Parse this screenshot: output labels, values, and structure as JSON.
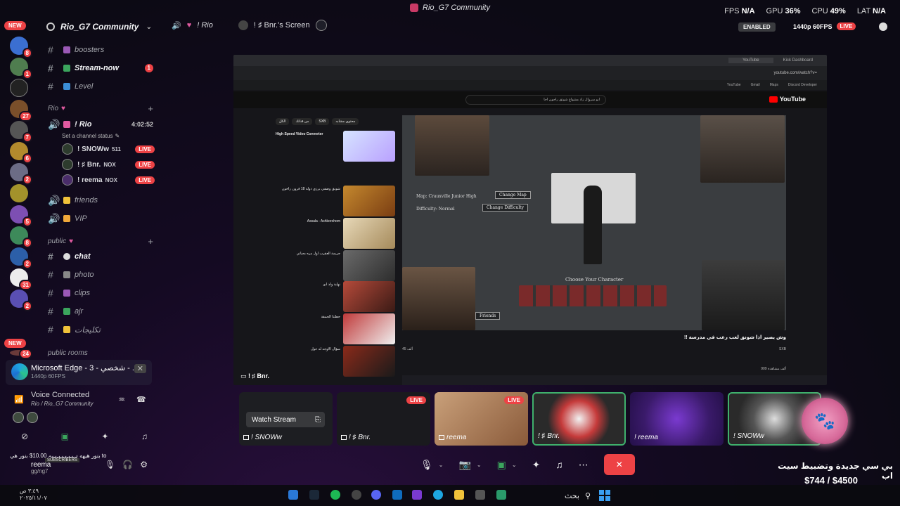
{
  "window": {
    "title": "Rio_G7 Community"
  },
  "perf": {
    "fps_label": "FPS",
    "fps": "N/A",
    "gpu_label": "GPU",
    "gpu": "36%",
    "cpu_label": "CPU",
    "cpu": "49%",
    "lat_label": "LAT",
    "lat": "N/A"
  },
  "rail": {
    "new_top": "NEW",
    "new_bottom": "NEW",
    "badges": [
      "8",
      "1",
      "",
      "27",
      "7",
      "6",
      "2",
      "",
      "5",
      "8",
      "2",
      "31",
      "2",
      "24"
    ]
  },
  "server": {
    "name": "Rio_G7 Community"
  },
  "channels": {
    "top": [
      {
        "name": "boosters"
      },
      {
        "name": "Stream-now",
        "count": "1"
      },
      {
        "name": "Level"
      }
    ],
    "cat_rio": "Rio",
    "voice_channel": "! Rio",
    "voice_time": "4:02:52",
    "set_status": "Set a channel status",
    "voice_users": [
      {
        "name": "! SNOWw",
        "tag": "511",
        "live": "LIVE"
      },
      {
        "name": "! ♯ Bnr.",
        "tag": "NOX",
        "live": "LIVE"
      },
      {
        "name": "! reema",
        "tag": "NOX",
        "live": "LIVE"
      }
    ],
    "friends": "friends",
    "vip": "VIP",
    "cat_public": "public",
    "public": [
      "chat",
      "photo",
      "clips",
      "ajr",
      "تكليجات"
    ],
    "cat_rooms": "public rooms"
  },
  "edge_card": {
    "title": "Microsoft Edge - 3 - شخصي - ...",
    "sub": "1440p 60FPS",
    "close": "✕"
  },
  "voice": {
    "status": "Voice Connected",
    "channel": "Rio / Rio_G7 Community"
  },
  "user_panel": {
    "ticker": "بنور هيهه  ہہہہہہہہہ 10.00$ بنور هي to",
    "subs_label": "SUBSCRIBERS",
    "name": "reema",
    "status": "gg/ng7"
  },
  "voice_header": {
    "channel": "! Rio",
    "screen": "! ♯ Bnr.'s Screen"
  },
  "stream_badges": {
    "enabled": "ENABLED",
    "quality": "1440p 60FPS",
    "live": "LIVE"
  },
  "stream": {
    "label": "! ♯ Bnr.",
    "yt_search": "ابو سروال زاد مشواع شوتق راحون احا",
    "yt_logo": "YouTube",
    "chips": [
      "الكل",
      "من قناتك",
      "SXB",
      "محتوى مشابه"
    ],
    "sidebar_videos": [
      "High Speed Video Converter",
      "شونق وصفي يرزي دولة 18 قرون راحون",
      "Assala - Ashkorohom",
      "جريمة العقرب اول مره بحياتي",
      "نهاية ولد ابو",
      "حطتنا الحمقة",
      "سؤال الاوجه له حول"
    ],
    "game_map": "Map: Crauxville Junior High",
    "game_difficulty": "Difficulty: Normal",
    "btn_map": "Change Map",
    "btn_difficulty": "Change Difficulty",
    "choose": "Choose Your Character",
    "friends_btn": "Friends",
    "video_title": "!! وش يصير اذا شونق لعب رعب في مدرسة",
    "channel": "SXB",
    "likes": "45 ألف",
    "views": "909 ألف مشاهدة"
  },
  "tiles": [
    {
      "name": "! SNOWw",
      "watch": "Watch Stream"
    },
    {
      "name": "! ♯ Bnr.",
      "live": "LIVE"
    },
    {
      "name": "reema",
      "live": "LIVE"
    },
    {
      "name": "! ♯ Bnr."
    },
    {
      "name": "! reema"
    },
    {
      "name": "! SNOWw"
    }
  ],
  "goal": {
    "text": "بي سي جديدة وتضبيط سيت اب",
    "amount": "$744 / $4500"
  },
  "taskbar": {
    "time": "٣:٤٩ ص",
    "date": "٢٠٢٥/١١/٠٧",
    "search": "بحث"
  },
  "colors": {
    "live": "#ed4245",
    "accent": "#5865f2",
    "bg": "#140a22"
  }
}
